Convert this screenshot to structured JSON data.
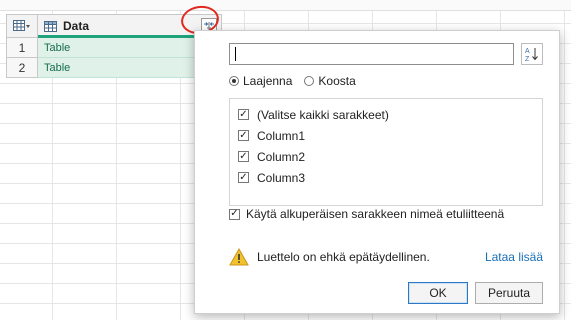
{
  "table": {
    "column_header": "Data",
    "rows": [
      {
        "num": "1",
        "value": "Table"
      },
      {
        "num": "2",
        "value": "Table"
      }
    ]
  },
  "popup": {
    "search": {
      "value": "",
      "placeholder": ""
    },
    "mode": {
      "expand_label": "Laajenna",
      "aggregate_label": "Koosta",
      "selected": "Laajenna"
    },
    "columns": [
      {
        "label": "(Valitse kaikki sarakkeet)",
        "checked": true
      },
      {
        "label": "Column1",
        "checked": true
      },
      {
        "label": "Column2",
        "checked": true
      },
      {
        "label": "Column3",
        "checked": true
      }
    ],
    "use_prefix_label": "Käytä alkuperäisen sarakkeen nimeä etuliitteenä",
    "warning_text": "Luettelo on ehkä epätäydellinen.",
    "load_more_label": "Lataa lisää",
    "ok_label": "OK",
    "cancel_label": "Peruuta"
  },
  "colors": {
    "accent_green": "#1fa37c",
    "cell_fill": "#dff1e9",
    "link_blue": "#1a6fb5",
    "highlight_red": "#e0281e"
  }
}
